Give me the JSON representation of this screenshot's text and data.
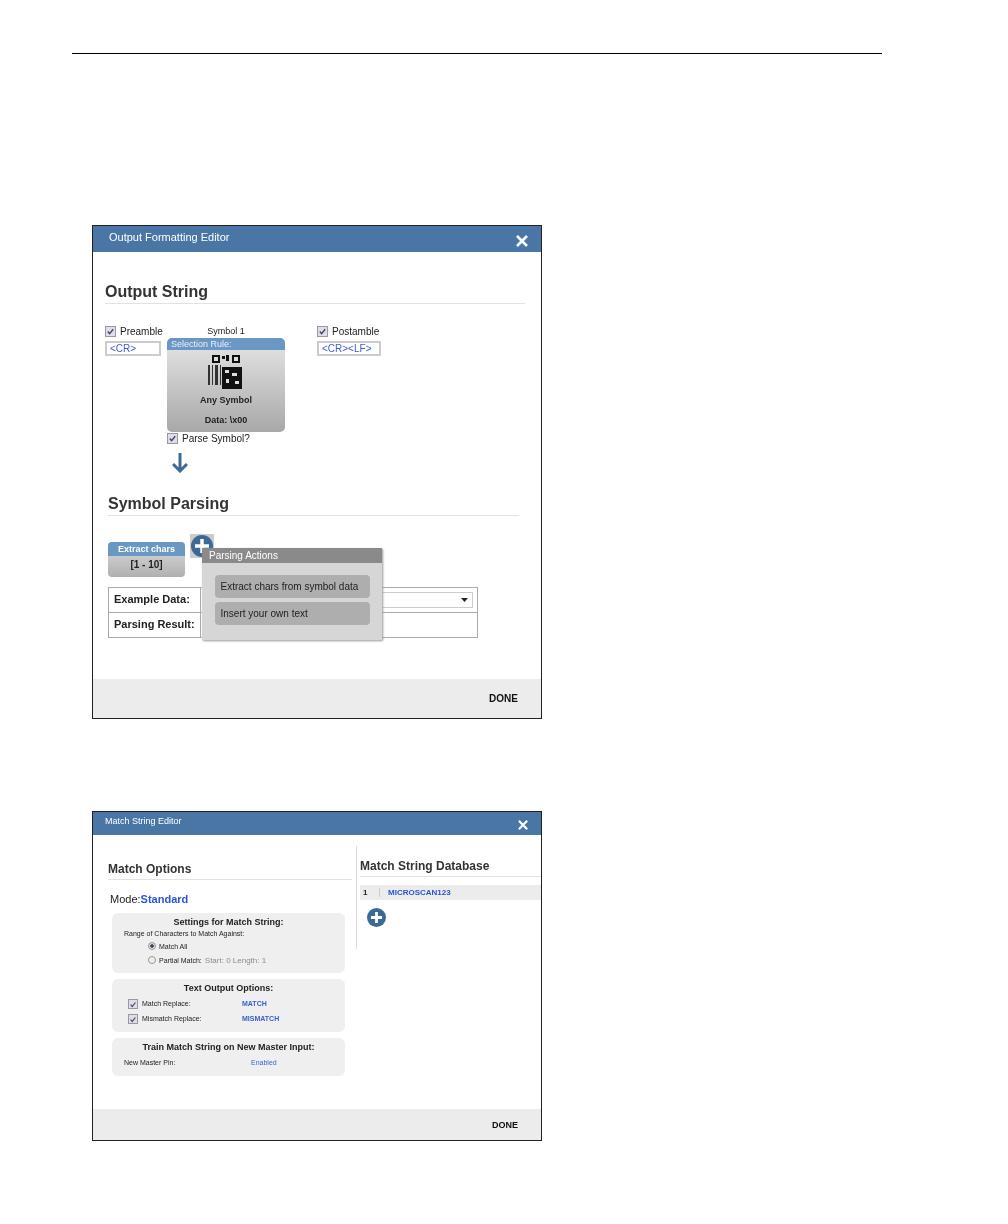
{
  "output_editor": {
    "title": "Output Formatting Editor",
    "heading": "Output String",
    "preamble": {
      "label": "Preamble",
      "checked": true,
      "value": "<CR>"
    },
    "symbol": {
      "label": "Symbol 1",
      "rule_label": "Selection Rule:",
      "name": "Any Symbol",
      "data": "Data: \\x00",
      "parse_label": "Parse Symbol?",
      "parse_checked": true
    },
    "postamble": {
      "label": "Postamble",
      "checked": true,
      "value": "<CR><LF>"
    },
    "parsing_heading": "Symbol Parsing",
    "parse_step": {
      "title": "Extract chars",
      "range": "[1 - 10]"
    },
    "table_rows": [
      {
        "label": "Example Data:",
        "kind": "select"
      },
      {
        "label": "Parsing Result:",
        "kind": "text"
      }
    ],
    "popup": {
      "title": "Parsing Actions",
      "actions": [
        "Extract chars from symbol data",
        "Insert your own text"
      ]
    },
    "done": "DONE"
  },
  "match_editor": {
    "title": "Match String Editor",
    "options_heading": "Match Options",
    "mode_label": "Mode:",
    "mode_value": "Standard",
    "panels": [
      {
        "title": "Settings for Match String:",
        "kind": "radio",
        "caption": "Range of Characters to Match Against:",
        "options": [
          {
            "label": "Match All",
            "selected": true
          },
          {
            "label": "Partial Match:",
            "selected": false,
            "detail": "Start: 0 Length: 1"
          }
        ]
      },
      {
        "title": "Text Output Options:",
        "kind": "checks",
        "items": [
          {
            "label": "Match Replace:",
            "checked": true,
            "value": "MATCH"
          },
          {
            "label": "Mismatch Replace:",
            "checked": true,
            "value": "MISMATCH"
          }
        ]
      },
      {
        "title": "Train Match String on New Master Input:",
        "kind": "pairs",
        "items": [
          {
            "label": "New Master Pin:",
            "value": "Enabled"
          }
        ]
      }
    ],
    "database_heading": "Match String Database",
    "database_rows": [
      {
        "index": "1",
        "value": "MICROSCAN123"
      }
    ],
    "done": "DONE"
  }
}
